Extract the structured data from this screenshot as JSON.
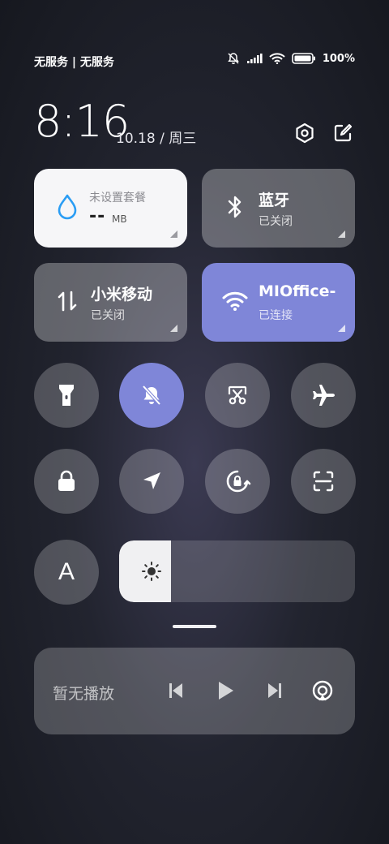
{
  "status_bar": {
    "carrier_text": "无服务 | 无服务",
    "battery_text": "100%",
    "icons": [
      "bell-off-icon",
      "signal-icon",
      "wifi-icon",
      "battery-icon"
    ]
  },
  "header": {
    "time": "8:16",
    "date": "10.18 / 周三",
    "icons": [
      "settings-icon",
      "edit-icon"
    ]
  },
  "tiles": {
    "data": {
      "title": "未设置套餐",
      "value": "--",
      "unit": "MB"
    },
    "bluetooth": {
      "title": "蓝牙",
      "status": "已关闭"
    },
    "mobile": {
      "title": "小米移动",
      "status": "已关闭"
    },
    "wifi": {
      "title": "MIOffice-",
      "status": "已连接"
    }
  },
  "quick_toggles": [
    "flashlight-icon",
    "silent-icon",
    "screenshot-icon",
    "airplane-icon",
    "lock-icon",
    "location-icon",
    "rotation-lock-icon",
    "scan-icon"
  ],
  "font_button": {
    "label": "A"
  },
  "brightness": {
    "level_fraction": 0.22,
    "icon": "sun-icon"
  },
  "media": {
    "status": "暂无播放",
    "icons": [
      "previous-icon",
      "play-icon",
      "next-icon",
      "cast-icon"
    ]
  },
  "colors": {
    "accent": "#7f86d8",
    "tile": "rgba(255,255,255,0.30)"
  }
}
